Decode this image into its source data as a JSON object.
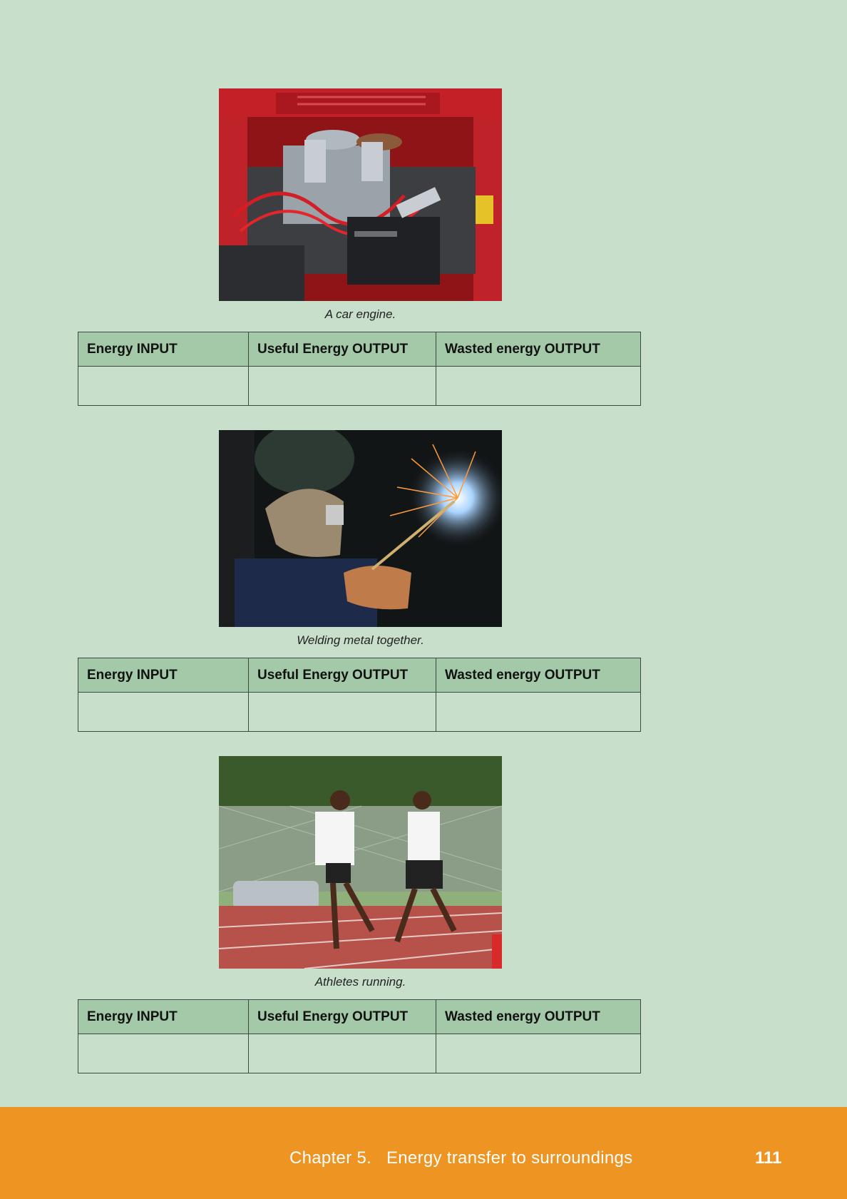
{
  "sections": [
    {
      "caption": "A car engine.",
      "photo_icon": "car-engine-photo",
      "table": {
        "headers": [
          "Energy INPUT",
          "Useful Energy OUTPUT",
          "Wasted energy OUTPUT"
        ],
        "row": [
          "",
          "",
          ""
        ]
      }
    },
    {
      "caption": "Welding metal together.",
      "photo_icon": "welding-photo",
      "table": {
        "headers": [
          "Energy INPUT",
          "Useful Energy OUTPUT",
          "Wasted energy OUTPUT"
        ],
        "row": [
          "",
          "",
          ""
        ]
      }
    },
    {
      "caption": "Athletes running.",
      "photo_icon": "athletes-photo",
      "table": {
        "headers": [
          "Energy INPUT",
          "Useful Energy OUTPUT",
          "Wasted energy OUTPUT"
        ],
        "row": [
          "",
          "",
          ""
        ]
      }
    }
  ],
  "footer": {
    "chapter": "Chapter 5.   Energy transfer to surroundings",
    "page_number": "111"
  },
  "colors": {
    "page_background": "#c8e0cb",
    "table_header": "#a3c9a8",
    "footer": "#ee9422"
  }
}
